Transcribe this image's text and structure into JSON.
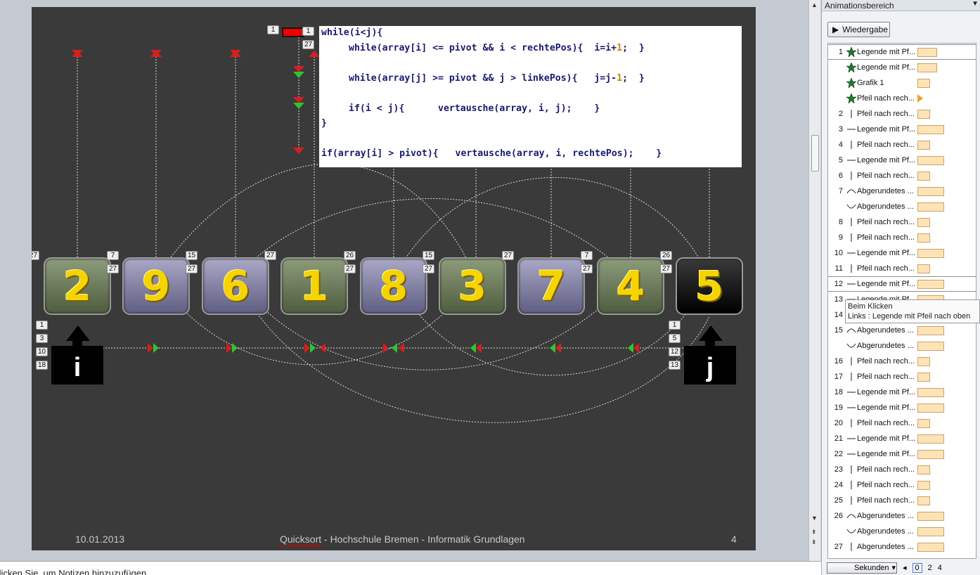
{
  "slide": {
    "tiles": [
      {
        "value": "2",
        "style": "g"
      },
      {
        "value": "9",
        "style": "p"
      },
      {
        "value": "6",
        "style": "p"
      },
      {
        "value": "1",
        "style": "g"
      },
      {
        "value": "8",
        "style": "p"
      },
      {
        "value": "3",
        "style": "g"
      },
      {
        "value": "7",
        "style": "p"
      },
      {
        "value": "4",
        "style": "g"
      },
      {
        "value": "5",
        "style": "b"
      }
    ],
    "code": {
      "line1": "while(i<j){",
      "line2a": "while(array[i] <= pivot && i < rechtePos){  i=i+",
      "line2b": "1",
      "line2c": ";  }",
      "line3a": "while(array[j] >= pivot && j > linkePos){   j=j-",
      "line3b": "1",
      "line3c": ";  }",
      "line4": "if(i < j){      vertausche(array, i, j);    }",
      "line5": "}",
      "line6": "if(array[i] > pivot){   vertausche(array, i, rechtePos);    }"
    },
    "pointer_i": "i",
    "pointer_j": "j",
    "markers": {
      "m_code_1a": "1",
      "m_code_1b": "1",
      "m_code_27": "27",
      "m_t0_left": "27",
      "m_t0_right": "7",
      "m_t0_right2": "27",
      "m_t1_right": "15",
      "m_t1_right2": "27",
      "m_t2_right": "27",
      "m_t3_right": "26",
      "m_t3_right2": "27",
      "m_t4_right": "15",
      "m_t4_right2": "27",
      "m_t5_right": "27",
      "m_t6_right": "7",
      "m_t6_right2": "27",
      "m_t7_right": "26",
      "m_t7_right2": "27",
      "m_i_1": "1",
      "m_i_3": "3",
      "m_i_10": "10",
      "m_i_18": "18",
      "m_j_1": "1",
      "m_j_5": "5",
      "m_j_12": "12",
      "m_j_13": "13"
    },
    "footer": {
      "date": "10.01.2013",
      "title_underlined": "Quicksort",
      "title_rest": " - Hochschule Bremen - Informatik Grundlagen",
      "page": "4"
    }
  },
  "notes_placeholder": "Klicken Sie, um Notizen hinzuzufügen",
  "animation_panel": {
    "title": "Animationsbereich",
    "play_label": "Wiedergabe",
    "items": [
      {
        "num": "1",
        "icon": "star",
        "label": "Legende mit Pf...",
        "bar": 28,
        "sel": true
      },
      {
        "num": "",
        "icon": "star",
        "label": "Legende mit Pf...",
        "bar": 28
      },
      {
        "num": "",
        "icon": "star",
        "label": "Grafik 1",
        "bar": 18
      },
      {
        "num": "",
        "icon": "star",
        "label": "Pfeil nach rech...",
        "bar": 0,
        "tri": true
      },
      {
        "num": "2",
        "icon": "vline",
        "label": "Pfeil nach rech...",
        "bar": 18
      },
      {
        "num": "3",
        "icon": "hline",
        "label": "Legende mit Pf...",
        "bar": 38
      },
      {
        "num": "4",
        "icon": "vline",
        "label": "Pfeil nach rech...",
        "bar": 18
      },
      {
        "num": "5",
        "icon": "hline",
        "label": "Legende mit Pf...",
        "bar": 38
      },
      {
        "num": "6",
        "icon": "vline",
        "label": "Pfeil nach rech...",
        "bar": 18
      },
      {
        "num": "7",
        "icon": "arc",
        "label": "Abgerundetes ...",
        "bar": 38
      },
      {
        "num": "",
        "icon": "arcd",
        "label": "Abgerundetes ...",
        "bar": 38
      },
      {
        "num": "8",
        "icon": "vline",
        "label": "Pfeil nach rech...",
        "bar": 18
      },
      {
        "num": "9",
        "icon": "vline",
        "label": "Pfeil nach rech...",
        "bar": 18
      },
      {
        "num": "10",
        "icon": "hline",
        "label": "Legende mit Pf...",
        "bar": 38
      },
      {
        "num": "11",
        "icon": "vline",
        "label": "Pfeil nach rech...",
        "bar": 18
      },
      {
        "num": "12",
        "icon": "hline",
        "label": "Legende mit Pf...",
        "bar": 38,
        "sel": true
      },
      {
        "num": "13",
        "icon": "hline",
        "label": "Legende mit Pf...",
        "bar": 38
      },
      {
        "num": "14",
        "icon": "vline",
        "label": "Pfeil nach rech...",
        "bar": 18
      },
      {
        "num": "15",
        "icon": "arc",
        "label": "Abgerundetes ...",
        "bar": 38
      },
      {
        "num": "",
        "icon": "arcd",
        "label": "Abgerundetes ...",
        "bar": 38
      },
      {
        "num": "16",
        "icon": "vline",
        "label": "Pfeil nach rech...",
        "bar": 18
      },
      {
        "num": "17",
        "icon": "vline",
        "label": "Pfeil nach rech...",
        "bar": 18
      },
      {
        "num": "18",
        "icon": "hline",
        "label": "Legende mit Pf...",
        "bar": 38
      },
      {
        "num": "19",
        "icon": "hline",
        "label": "Legende mit Pf...",
        "bar": 38
      },
      {
        "num": "20",
        "icon": "vline",
        "label": "Pfeil nach rech...",
        "bar": 18
      },
      {
        "num": "21",
        "icon": "hline",
        "label": "Legende mit Pf...",
        "bar": 38
      },
      {
        "num": "22",
        "icon": "hline",
        "label": "Legende mit Pf...",
        "bar": 38
      },
      {
        "num": "23",
        "icon": "vline",
        "label": "Pfeil nach rech...",
        "bar": 18
      },
      {
        "num": "24",
        "icon": "vline",
        "label": "Pfeil nach rech...",
        "bar": 18
      },
      {
        "num": "25",
        "icon": "vline",
        "label": "Pfeil nach rech...",
        "bar": 18
      },
      {
        "num": "26",
        "icon": "arc",
        "label": "Abgerundetes ...",
        "bar": 38
      },
      {
        "num": "",
        "icon": "arcd",
        "label": "Abgerundetes ...",
        "bar": 38
      },
      {
        "num": "27",
        "icon": "vline",
        "label": "Abgerundetes ...",
        "bar": 38
      }
    ],
    "tooltip_line1": "Beim Klicken",
    "tooltip_line2": "Links : Legende mit Pfeil nach oben",
    "timeline": {
      "unit": "Sekunden",
      "ticks": [
        "0",
        "2",
        "4"
      ]
    }
  }
}
